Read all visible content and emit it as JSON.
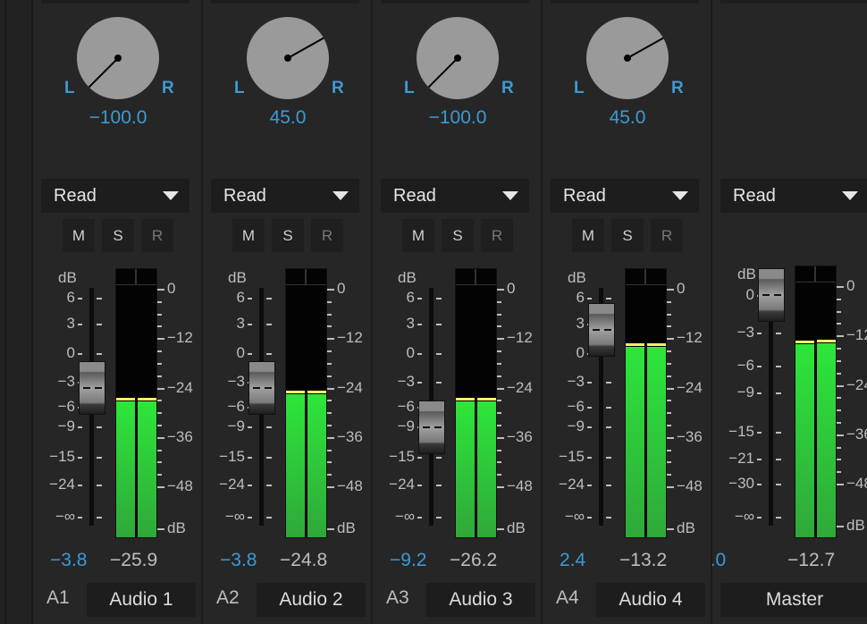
{
  "common": {
    "automation_mode": "Read",
    "mute": "M",
    "solo": "S",
    "record": "R",
    "db_label": "dB",
    "pan_left": "L",
    "pan_right": "R",
    "dropdown_icon": "triangle-down-icon"
  },
  "colors": {
    "value_blue": "#3a9bd6",
    "meter_green": "#2de63a",
    "peak_yellow": "#f0f060"
  },
  "fader_scale": [
    "6",
    "3",
    "0",
    "−3",
    "−6",
    "−9",
    "−15",
    "−24",
    "−∞"
  ],
  "master_fader_scale": [
    "0",
    "−3",
    "−6",
    "−9",
    "−15",
    "−21",
    "−30",
    "−∞"
  ],
  "meter_scale": [
    "0",
    "−12",
    "−24",
    "−36",
    "−48",
    "dB"
  ],
  "channels": [
    {
      "id": "A1",
      "name": "Audio 1",
      "pan": "−100.0",
      "pan_value": -100,
      "fader": "−3.8",
      "fader_value": -3.8,
      "peak": "−25.9",
      "meter_level_db": [
        -26.5,
        -26.5
      ]
    },
    {
      "id": "A2",
      "name": "Audio 2",
      "pan": "45.0",
      "pan_value": 45,
      "fader": "−3.8",
      "fader_value": -3.8,
      "peak": "−24.8",
      "meter_level_db": [
        -24.8,
        -24.8
      ]
    },
    {
      "id": "A3",
      "name": "Audio 3",
      "pan": "−100.0",
      "pan_value": -100,
      "fader": "−9.2",
      "fader_value": -9.2,
      "peak": "−26.2",
      "meter_level_db": [
        -26.5,
        -26.5
      ]
    },
    {
      "id": "A4",
      "name": "Audio 4",
      "pan": "45.0",
      "pan_value": 45,
      "fader": "2.4",
      "fader_value": 2.4,
      "peak": "−13.2",
      "meter_level_db": [
        -13.2,
        -13.2
      ]
    },
    {
      "id": "",
      "name": "Master",
      "pan": "",
      "pan_value": null,
      "fader": "0.0",
      "fader_value": 0,
      "peak": "−12.7",
      "meter_level_db": [
        -12.7,
        -12.3
      ],
      "master": true
    }
  ]
}
